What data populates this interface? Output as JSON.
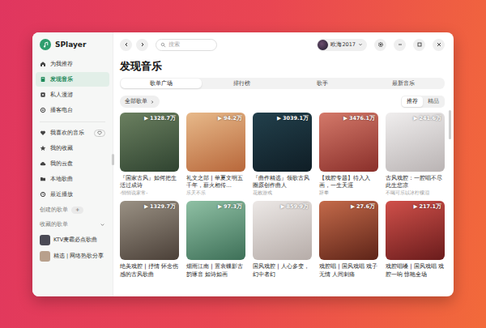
{
  "app": {
    "name": "SPlayer"
  },
  "search": {
    "placeholder": "搜索"
  },
  "user": {
    "name": "欧海2017"
  },
  "sidebar": {
    "items": [
      {
        "label": "为我推荐",
        "selected": false
      },
      {
        "label": "发现音乐",
        "selected": true
      },
      {
        "label": "私人漫游",
        "selected": false
      },
      {
        "label": "播客电台",
        "selected": false
      }
    ],
    "library": [
      {
        "label": "我喜欢的音乐",
        "selected": false
      },
      {
        "label": "我的收藏",
        "selected": false
      },
      {
        "label": "我的云盘",
        "selected": false
      },
      {
        "label": "本地歌曲",
        "selected": false
      },
      {
        "label": "最近播放",
        "selected": false
      }
    ],
    "sections": [
      {
        "title": "创建的歌单",
        "add": "+"
      },
      {
        "title": "收藏的歌单",
        "expanded": true
      }
    ],
    "playlists": [
      {
        "label": "KTV麦霸必点歌曲"
      },
      {
        "label": "精选 | 网络热歌分享"
      }
    ]
  },
  "page": {
    "title": "发现音乐",
    "tabs": [
      {
        "label": "歌单广场",
        "selected": true
      },
      {
        "label": "排行榜",
        "selected": false
      },
      {
        "label": "歌手",
        "selected": false
      },
      {
        "label": "最新音乐",
        "selected": false
      }
    ],
    "filter": "全部歌单",
    "sort": [
      {
        "label": "推荐",
        "selected": true
      },
      {
        "label": "精品",
        "selected": false
      }
    ]
  },
  "play_glyph": "▶",
  "cards": [
    {
      "count": "1328.7万",
      "title": "『国家古风』如何把生活过成诗",
      "subtitle": "-悄悄说家常-"
    },
    {
      "count": "94.2万",
      "title": "礼文之部 | 華夏文明五千年，薪火相传…",
      "subtitle": "乐天不乐"
    },
    {
      "count": "3039.1万",
      "title": "『曲作精选』领歌古风圈原创作曲人",
      "subtitle": "花败游戏"
    },
    {
      "count": "3476.1万",
      "title": "【戏腔专题】待入入画，一生天涯",
      "subtitle": "辞奉"
    },
    {
      "count": "241.6万",
      "title": "古风戏腔：一腔唱不尽此生悲凉",
      "subtitle": "不喝可乐以冰柠檬泪"
    },
    {
      "count": "1329.7万",
      "title": "绝美戏腔 | 抒情 怀念伤感的古风歌曲"
    },
    {
      "count": "97.3万",
      "title": "烟雨江南 | 置衷蝶影古韵琢音 如诗如画"
    },
    {
      "count": "859.9万",
      "title": "国风戏腔 | 人心多变，幻中者幻"
    },
    {
      "count": "27.6万",
      "title": "戏腔唱 | 国风戏唱 戏子无情 人间刺痛"
    },
    {
      "count": "217.1万",
      "title": "戏腔唱嗓 | 国风戏唱 戏腔一响 惊艳全场"
    }
  ]
}
